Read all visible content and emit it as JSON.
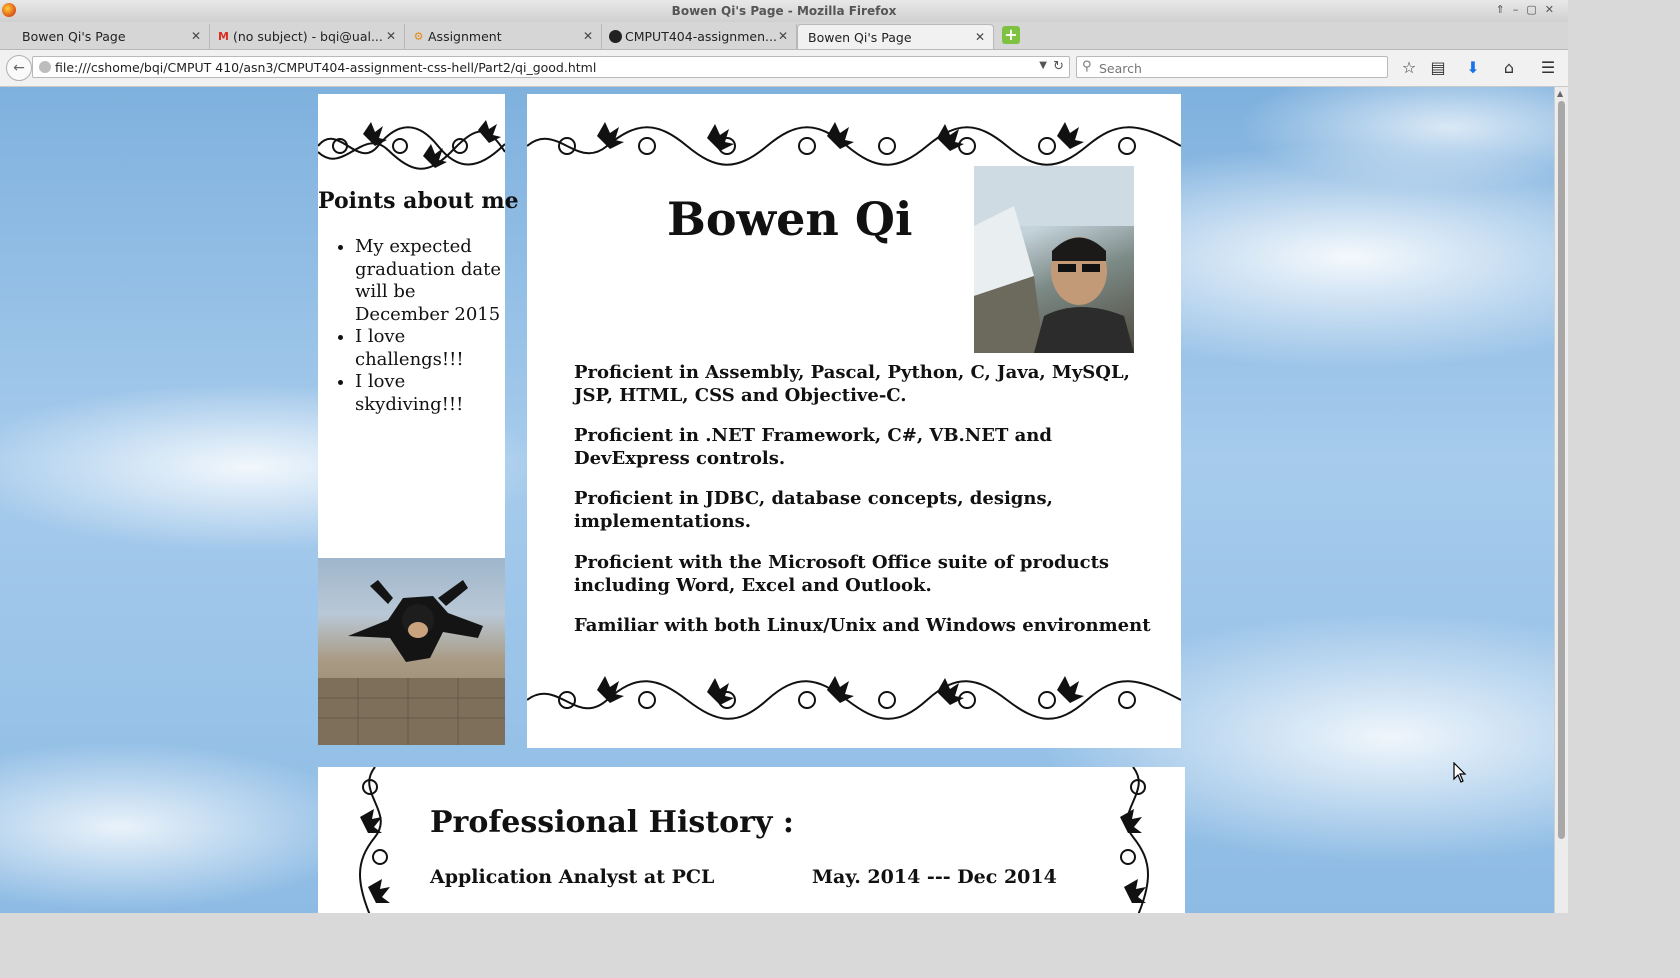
{
  "window": {
    "title": "Bowen Qi's Page - Mozilla Firefox"
  },
  "tabs": [
    {
      "label": "Bowen Qi's Page",
      "icon": "page-icon"
    },
    {
      "label": "(no subject) - bqi@ual...",
      "icon": "gmail-icon"
    },
    {
      "label": "Assignment",
      "icon": "assignment-icon"
    },
    {
      "label": "CMPUT404-assignmen...",
      "icon": "github-icon"
    },
    {
      "label": "Bowen Qi's Page",
      "icon": "page-icon",
      "active": true
    }
  ],
  "nav": {
    "url": "file:///cshome/bqi/CMPUT 410/asn3/CMPUT404-assignment-css-hell/Part2/qi_good.html",
    "search_placeholder": "Search"
  },
  "page": {
    "points_heading": "Points about me",
    "points": [
      "My expected graduation date will be December 2015",
      "I love challengs!!!",
      "I love skydiving!!!"
    ],
    "name": "Bowen Qi",
    "skills": [
      "Proficient in Assembly, Pascal, Python, C, Java, MySQL, JSP, HTML, CSS and Objective-C.",
      "Proficient in .NET Framework, C#, VB.NET and DevExpress controls.",
      "Proficient in JDBC, database concepts, designs, implementations.",
      "Proficient with the Microsoft Office suite of products including Word, Excel and Outlook.",
      "Familiar with both Linux/Unix and Windows environment"
    ],
    "history_title": "Professional History :",
    "jobs": [
      {
        "title": "Application Analyst at PCL",
        "dates": "May. 2014 --- Dec 2014"
      }
    ]
  },
  "colors": {
    "sky": "#8dbbe4",
    "panel": "#ffffff",
    "text": "#111111"
  }
}
